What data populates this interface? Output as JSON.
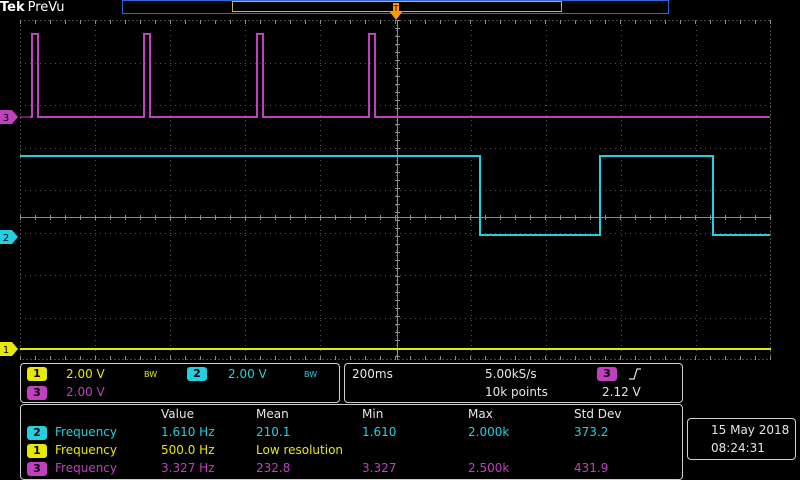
{
  "header": {
    "brand": "Tek",
    "mode": "PreVu"
  },
  "channels": {
    "ch1": {
      "number": "1",
      "scale": "2.00 V",
      "bw_limit": "BW",
      "color": "#e8e800"
    },
    "ch2": {
      "number": "2",
      "scale": "2.00 V",
      "bw_limit": "BW",
      "color": "#22d0e0"
    },
    "ch3": {
      "number": "3",
      "scale": "2.00 V",
      "color": "#c040c0"
    }
  },
  "horizontal": {
    "timebase": "200ms",
    "sample_rate": "5.00kS/s",
    "record_length": "10k points"
  },
  "trigger": {
    "source": "3",
    "slope_icon": "rising-edge-icon",
    "level": "2.12 V"
  },
  "measurements": {
    "headers": {
      "value": "Value",
      "mean": "Mean",
      "min": "Min",
      "max": "Max",
      "std": "Std Dev"
    },
    "rows": [
      {
        "channel": "2",
        "name": "Frequency",
        "value": "1.610 Hz",
        "mean": "210.1",
        "min": "1.610",
        "max": "2.000k",
        "std": "373.2"
      },
      {
        "channel": "1",
        "name": "Frequency",
        "value": "500.0 Hz",
        "mean": "Low resolution",
        "min": "",
        "max": "",
        "std": ""
      },
      {
        "channel": "3",
        "name": "Frequency",
        "value": "3.327 Hz",
        "mean": "232.8",
        "min": "3.327",
        "max": "2.500k",
        "std": "431.9"
      }
    ]
  },
  "datetime": {
    "date": "15 May 2018",
    "time": "08:24:31"
  },
  "colors": {
    "grid": "#8c8c8c",
    "ch1": "#e8e800",
    "ch2": "#22d0e0",
    "ch3": "#c040c0",
    "trigger": "#ff9900",
    "record_bar": "#2a6ad0"
  }
}
